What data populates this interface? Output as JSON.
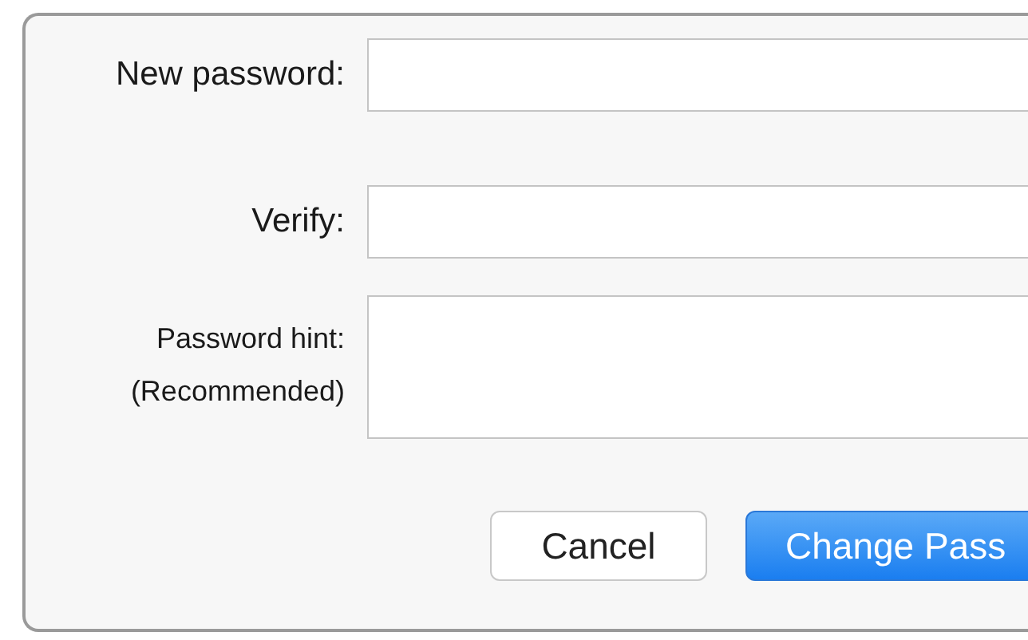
{
  "form": {
    "fields": [
      {
        "label": "New password:",
        "kind": "single"
      },
      {
        "label": "Verify:",
        "kind": "single"
      },
      {
        "label": "Password hint:",
        "sublabel": "(Recommended)",
        "kind": "multi"
      }
    ]
  },
  "buttons": [
    {
      "label": "Cancel",
      "kind": "secondary"
    },
    {
      "label": "Change Pass",
      "kind": "primary"
    }
  ]
}
